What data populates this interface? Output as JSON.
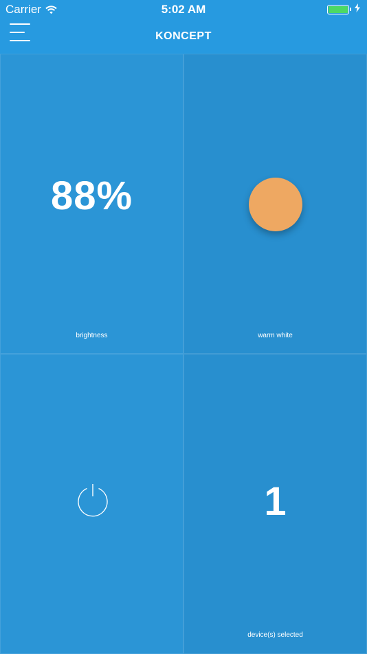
{
  "status_bar": {
    "carrier": "Carrier",
    "time": "5:02 AM",
    "battery_color": "#4cd964"
  },
  "nav": {
    "title": "KONCEPT",
    "menu_icon": "hamburger-menu-icon"
  },
  "tiles": {
    "brightness": {
      "value": "88%",
      "label": "brightness"
    },
    "color": {
      "label": "warm white",
      "swatch_color": "#eea862"
    },
    "power": {
      "icon": "power-icon"
    },
    "devices": {
      "count": "1",
      "label": "device(s) selected"
    }
  },
  "colors": {
    "bar_background": "#279ae0",
    "tile_light": "#2b95d6",
    "tile_dark": "#288fcf",
    "text": "#ffffff"
  }
}
